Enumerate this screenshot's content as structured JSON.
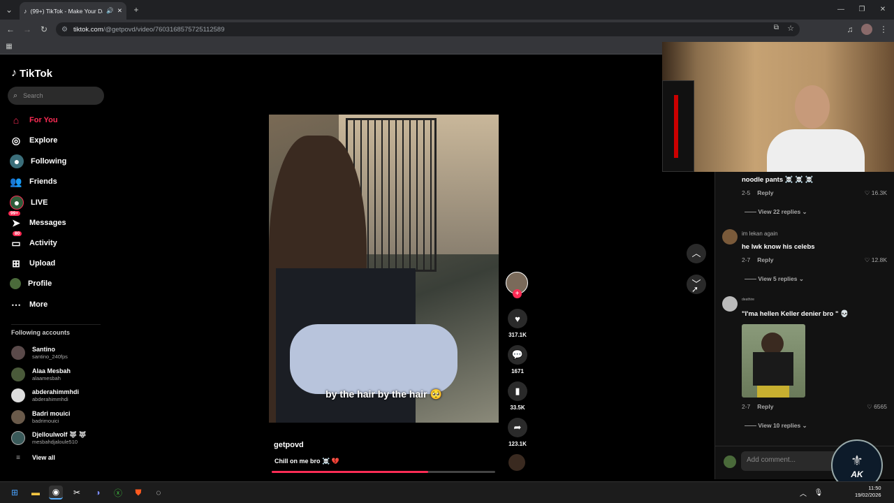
{
  "browser": {
    "tab_title": "(99+) TikTok - Make Your Da",
    "url_host": "tiktok.com",
    "url_path": "/@getpovd/video/7603168575725112589"
  },
  "sidebar": {
    "logo": "TikTok",
    "search_placeholder": "Search",
    "items": [
      {
        "label": "For You",
        "icon": "home-icon"
      },
      {
        "label": "Explore",
        "icon": "compass-icon"
      },
      {
        "label": "Following",
        "icon": "following-icon"
      },
      {
        "label": "Friends",
        "icon": "friends-icon"
      },
      {
        "label": "LIVE",
        "icon": "live-icon"
      },
      {
        "label": "Messages",
        "icon": "messages-icon",
        "badge": "99+"
      },
      {
        "label": "Activity",
        "icon": "activity-icon",
        "badge": "80"
      },
      {
        "label": "Upload",
        "icon": "upload-icon"
      },
      {
        "label": "Profile",
        "icon": "profile-icon"
      },
      {
        "label": "More",
        "icon": "more-icon"
      }
    ],
    "following_heading": "Following accounts",
    "accounts": [
      {
        "name": "Santino",
        "handle": "santino_240fps"
      },
      {
        "name": "Alaa Mesbah",
        "handle": "alaamesbah"
      },
      {
        "name": "abderahimmhdi",
        "handle": "abderahimmhdi"
      },
      {
        "name": "Badri mouici",
        "handle": "badrimouici"
      },
      {
        "name": "Djelloulwolf 🐺 🐺",
        "handle": "mesbahdjaloule510"
      }
    ],
    "view_all": "View all"
  },
  "video": {
    "subtitle": "by the hair by the hair 🥺",
    "author": "getpovd",
    "caption": "Chill on me bro ☠️ 💔",
    "progress": 0.7,
    "likes": "317.1K",
    "comments": "1671",
    "saves": "33.5K",
    "shares": "123.1K"
  },
  "comments": [
    {
      "user": "",
      "text": "noodle pants ☠️ ☠️ ☠️",
      "date": "2-5",
      "reply": "Reply",
      "likes": "16.3K",
      "view_replies": "View 22 replies"
    },
    {
      "user": "im lekan again",
      "text": "he lwk know his celebs",
      "date": "2-7",
      "reply": "Reply",
      "likes": "12.8K",
      "view_replies": "View 5 replies"
    },
    {
      "user": "deathire",
      "text": "\"I'ma hellen Keller denier bro \" 💀",
      "date": "2-7",
      "reply": "Reply",
      "likes": "6565",
      "view_replies": "View 10 replies"
    }
  ],
  "comment_input_placeholder": "Add comment...",
  "taskbar": {
    "time": "11:50",
    "date": "19/02/2026"
  },
  "colors": {
    "accent": "#fe2c55",
    "background": "#000000"
  }
}
